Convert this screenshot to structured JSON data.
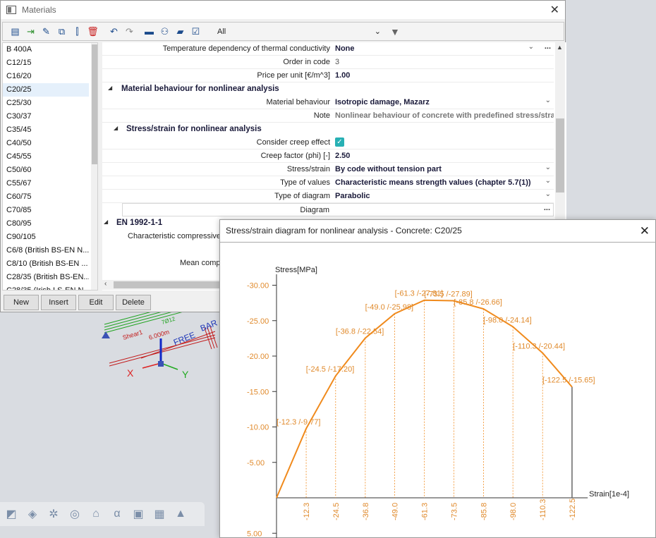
{
  "materials_window": {
    "title": "Materials",
    "toolbar": {
      "icons": [
        "new-material-icon",
        "insert-icon",
        "edit-icon",
        "copy-icon",
        "import-icon",
        "delete-icon",
        "undo-icon",
        "redo-icon",
        "library-icon",
        "users-icon",
        "open-icon",
        "export-icon"
      ],
      "filter_value": "All"
    },
    "list_items": [
      "B 400A",
      "C12/15",
      "C16/20",
      "C20/25",
      "C25/30",
      "C30/37",
      "C35/45",
      "C40/50",
      "C45/55",
      "C50/60",
      "C55/67",
      "C60/75",
      "C70/85",
      "C80/95",
      "C90/105",
      "C6/8 (British BS-EN N...",
      "C8/10 (British BS-EN ...",
      "C28/35 (British BS-EN...",
      "C28/35 (Irish I.S-EN N..."
    ],
    "selected_item": "C20/25",
    "properties": {
      "temp_dependency": {
        "label": "Temperature dependency of thermal conductivity",
        "value": "None"
      },
      "order_in_code": {
        "label": "Order in code",
        "value": "3"
      },
      "price_per_unit": {
        "label": "Price per unit [€/m^3]",
        "value": "1.00"
      },
      "section_nonlinear": "Material behaviour for nonlinear analysis",
      "material_behaviour": {
        "label": "Material behaviour",
        "value": "Isotropic damage, Mazarz"
      },
      "note": {
        "label": "Note",
        "value": "Nonlinear behaviour of concrete with predefined stress/strain"
      },
      "section_stress_strain": "Stress/strain for nonlinear analysis",
      "consider_creep": {
        "label": "Consider creep effect",
        "value": "✓"
      },
      "creep_factor": {
        "label": "Creep factor (phi) [-]",
        "value": "2.50"
      },
      "stress_strain": {
        "label": "Stress/strain",
        "value": "By code without tension part"
      },
      "type_of_values": {
        "label": "Type of values",
        "value": "Characteristic means strength values (chapter 5.7(1))"
      },
      "type_of_diagram": {
        "label": "Type of diagram",
        "value": "Parabolic"
      },
      "diagram": {
        "label": "Diagram",
        "value": ""
      },
      "section_en": "EN 1992-1-1",
      "char_compressive": {
        "label": "Characteristic compressive"
      },
      "mean_comp": {
        "label": "Mean comp"
      }
    },
    "buttons": {
      "new": "New",
      "insert": "Insert",
      "edit": "Edit",
      "delete": "Delete"
    }
  },
  "diagram_window": {
    "title": "Stress/strain diagram for nonlinear analysis - Concrete: C20/25"
  },
  "viewport": {
    "labels": {
      "shear": "Shear1",
      "length": "6.000m",
      "free": "FREE",
      "bar": "BAR",
      "bars": "7Ø12"
    }
  },
  "chart_data": {
    "type": "line",
    "ylabel": "Stress[MPa]",
    "xlabel": "Strain[1e-4]",
    "x": [
      0,
      -12.3,
      -24.5,
      -36.8,
      -49.0,
      -61.3,
      -73.5,
      -85.8,
      -98.0,
      -110.3,
      -122.5
    ],
    "y": [
      0,
      -9.77,
      -17.2,
      -22.54,
      -25.98,
      -27.89,
      -27.81,
      -26.66,
      -24.14,
      -20.44,
      -15.65
    ],
    "point_labels": [
      "",
      "[-12.3 /-9.77]",
      "[-24.5 /-17.20]",
      "[-36.8 /-22.54]",
      "[-49.0 /-25.98]",
      "[-61.3 /-27.81]",
      "[-73.5 /-27.89]",
      "[-85.8 /-26.66]",
      "[-98.0 /-24.14]",
      "[-110.3 /-20.44]",
      "[-122.5 /-15.65]"
    ],
    "x_ticks": [
      "-12.3",
      "-24.5",
      "-36.8",
      "-49.0",
      "-61.3",
      "-73.5",
      "-85.8",
      "-98.0",
      "-110.3",
      "-122.5"
    ],
    "y_ticks": [
      "-30.00",
      "-25.00",
      "-20.00",
      "-15.00",
      "-10.00",
      "-5.00",
      "5.00"
    ],
    "y_tick_values": [
      -30,
      -25,
      -20,
      -15,
      -10,
      -5,
      5
    ],
    "line_color": "#f08a1c",
    "text_color": "#e08a2c"
  }
}
